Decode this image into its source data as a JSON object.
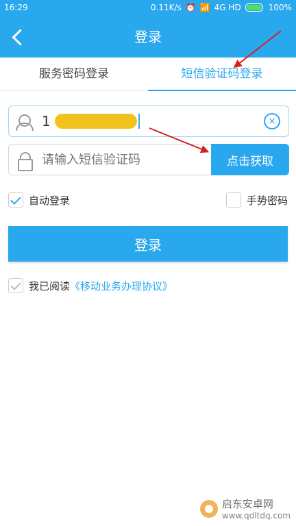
{
  "status": {
    "time": "16:29",
    "speed": "0.11K/s",
    "network": "4G HD",
    "battery": "100%"
  },
  "header": {
    "title": "登录"
  },
  "tabs": [
    {
      "label": "服务密码登录",
      "active": false
    },
    {
      "label": "短信验证码登录",
      "active": true
    }
  ],
  "phone": {
    "visible_prefix": "1"
  },
  "code": {
    "placeholder": "请输入短信验证码",
    "button": "点击获取"
  },
  "options": {
    "auto_login": "自动登录",
    "gesture": "手势密码"
  },
  "login_button": "登录",
  "agreement": {
    "prefix": "我已阅读",
    "link": "《移动业务办理协议》"
  },
  "watermark": {
    "text": "启东安卓网",
    "subtext": "www.qdltdq.com"
  },
  "colors": {
    "accent": "#2aa8ee",
    "annotation": "#d62020"
  }
}
